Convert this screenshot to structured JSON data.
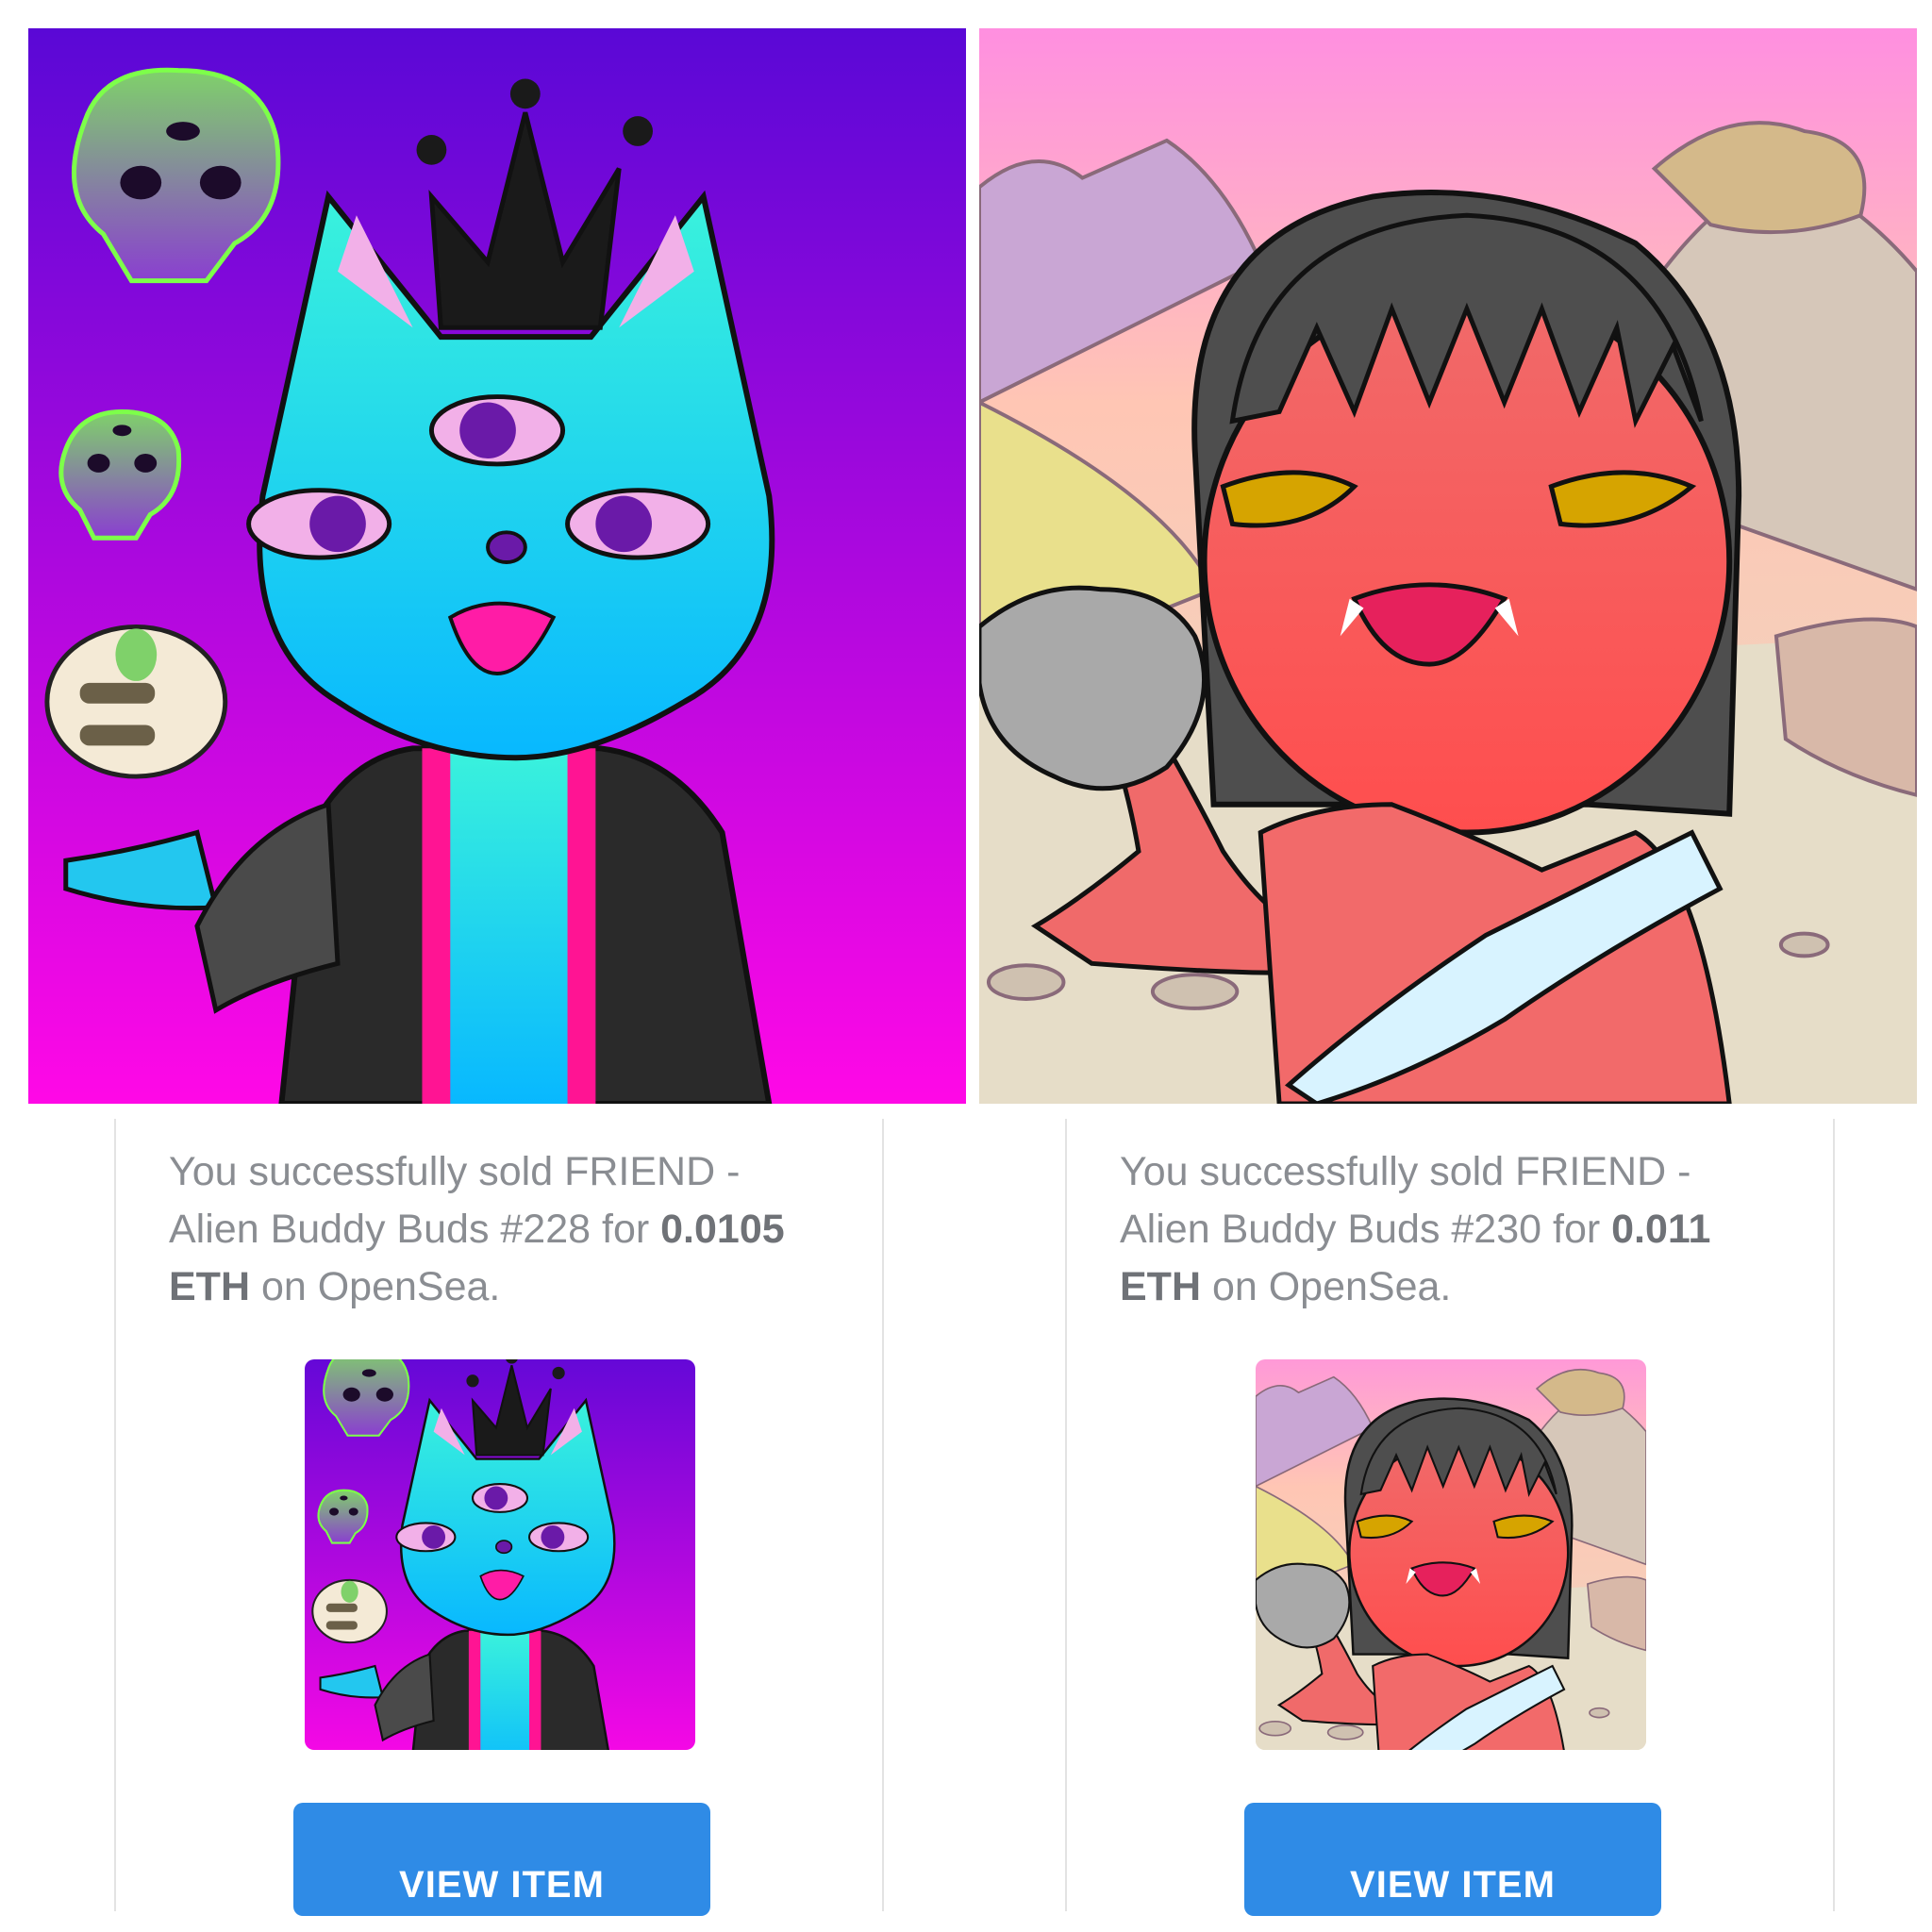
{
  "cards": [
    {
      "prefix": "You successfully sold FRIEND - Alien Buddy Buds #228 for ",
      "price": "0.0105 ETH",
      "suffix": " on OpenSea.",
      "button_label": "VIEW ITEM"
    },
    {
      "prefix": "You successfully sold FRIEND - Alien Buddy Buds #230 for ",
      "price": "0.011 ETH",
      "suffix": " on OpenSea.",
      "button_label": "VIEW ITEM"
    }
  ],
  "colors": {
    "button": "#2f8be6",
    "text": "#8a8d92",
    "border": "#e3e3e3"
  },
  "artwork": [
    {
      "subject": "cat-alien-queen-icon",
      "background": [
        "#5a08d6",
        "#ff08e6"
      ]
    },
    {
      "subject": "red-ogre-woman-icon",
      "background": [
        "#ff8fe0",
        "#e8d8c0"
      ]
    }
  ]
}
